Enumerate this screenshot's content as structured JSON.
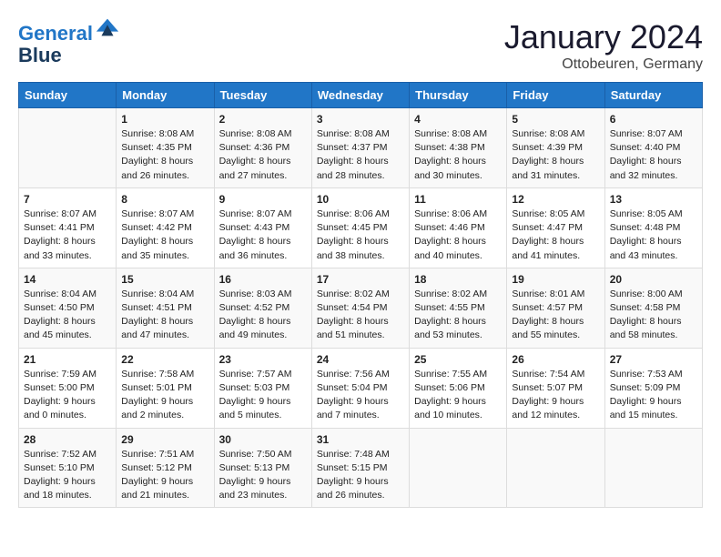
{
  "header": {
    "logo_line1": "General",
    "logo_line2": "Blue",
    "month": "January 2024",
    "location": "Ottobeuren, Germany"
  },
  "weekdays": [
    "Sunday",
    "Monday",
    "Tuesday",
    "Wednesday",
    "Thursday",
    "Friday",
    "Saturday"
  ],
  "weeks": [
    [
      {
        "day": "",
        "content": ""
      },
      {
        "day": "1",
        "content": "Sunrise: 8:08 AM\nSunset: 4:35 PM\nDaylight: 8 hours\nand 26 minutes."
      },
      {
        "day": "2",
        "content": "Sunrise: 8:08 AM\nSunset: 4:36 PM\nDaylight: 8 hours\nand 27 minutes."
      },
      {
        "day": "3",
        "content": "Sunrise: 8:08 AM\nSunset: 4:37 PM\nDaylight: 8 hours\nand 28 minutes."
      },
      {
        "day": "4",
        "content": "Sunrise: 8:08 AM\nSunset: 4:38 PM\nDaylight: 8 hours\nand 30 minutes."
      },
      {
        "day": "5",
        "content": "Sunrise: 8:08 AM\nSunset: 4:39 PM\nDaylight: 8 hours\nand 31 minutes."
      },
      {
        "day": "6",
        "content": "Sunrise: 8:07 AM\nSunset: 4:40 PM\nDaylight: 8 hours\nand 32 minutes."
      }
    ],
    [
      {
        "day": "7",
        "content": "Sunrise: 8:07 AM\nSunset: 4:41 PM\nDaylight: 8 hours\nand 33 minutes."
      },
      {
        "day": "8",
        "content": "Sunrise: 8:07 AM\nSunset: 4:42 PM\nDaylight: 8 hours\nand 35 minutes."
      },
      {
        "day": "9",
        "content": "Sunrise: 8:07 AM\nSunset: 4:43 PM\nDaylight: 8 hours\nand 36 minutes."
      },
      {
        "day": "10",
        "content": "Sunrise: 8:06 AM\nSunset: 4:45 PM\nDaylight: 8 hours\nand 38 minutes."
      },
      {
        "day": "11",
        "content": "Sunrise: 8:06 AM\nSunset: 4:46 PM\nDaylight: 8 hours\nand 40 minutes."
      },
      {
        "day": "12",
        "content": "Sunrise: 8:05 AM\nSunset: 4:47 PM\nDaylight: 8 hours\nand 41 minutes."
      },
      {
        "day": "13",
        "content": "Sunrise: 8:05 AM\nSunset: 4:48 PM\nDaylight: 8 hours\nand 43 minutes."
      }
    ],
    [
      {
        "day": "14",
        "content": "Sunrise: 8:04 AM\nSunset: 4:50 PM\nDaylight: 8 hours\nand 45 minutes."
      },
      {
        "day": "15",
        "content": "Sunrise: 8:04 AM\nSunset: 4:51 PM\nDaylight: 8 hours\nand 47 minutes."
      },
      {
        "day": "16",
        "content": "Sunrise: 8:03 AM\nSunset: 4:52 PM\nDaylight: 8 hours\nand 49 minutes."
      },
      {
        "day": "17",
        "content": "Sunrise: 8:02 AM\nSunset: 4:54 PM\nDaylight: 8 hours\nand 51 minutes."
      },
      {
        "day": "18",
        "content": "Sunrise: 8:02 AM\nSunset: 4:55 PM\nDaylight: 8 hours\nand 53 minutes."
      },
      {
        "day": "19",
        "content": "Sunrise: 8:01 AM\nSunset: 4:57 PM\nDaylight: 8 hours\nand 55 minutes."
      },
      {
        "day": "20",
        "content": "Sunrise: 8:00 AM\nSunset: 4:58 PM\nDaylight: 8 hours\nand 58 minutes."
      }
    ],
    [
      {
        "day": "21",
        "content": "Sunrise: 7:59 AM\nSunset: 5:00 PM\nDaylight: 9 hours\nand 0 minutes."
      },
      {
        "day": "22",
        "content": "Sunrise: 7:58 AM\nSunset: 5:01 PM\nDaylight: 9 hours\nand 2 minutes."
      },
      {
        "day": "23",
        "content": "Sunrise: 7:57 AM\nSunset: 5:03 PM\nDaylight: 9 hours\nand 5 minutes."
      },
      {
        "day": "24",
        "content": "Sunrise: 7:56 AM\nSunset: 5:04 PM\nDaylight: 9 hours\nand 7 minutes."
      },
      {
        "day": "25",
        "content": "Sunrise: 7:55 AM\nSunset: 5:06 PM\nDaylight: 9 hours\nand 10 minutes."
      },
      {
        "day": "26",
        "content": "Sunrise: 7:54 AM\nSunset: 5:07 PM\nDaylight: 9 hours\nand 12 minutes."
      },
      {
        "day": "27",
        "content": "Sunrise: 7:53 AM\nSunset: 5:09 PM\nDaylight: 9 hours\nand 15 minutes."
      }
    ],
    [
      {
        "day": "28",
        "content": "Sunrise: 7:52 AM\nSunset: 5:10 PM\nDaylight: 9 hours\nand 18 minutes."
      },
      {
        "day": "29",
        "content": "Sunrise: 7:51 AM\nSunset: 5:12 PM\nDaylight: 9 hours\nand 21 minutes."
      },
      {
        "day": "30",
        "content": "Sunrise: 7:50 AM\nSunset: 5:13 PM\nDaylight: 9 hours\nand 23 minutes."
      },
      {
        "day": "31",
        "content": "Sunrise: 7:48 AM\nSunset: 5:15 PM\nDaylight: 9 hours\nand 26 minutes."
      },
      {
        "day": "",
        "content": ""
      },
      {
        "day": "",
        "content": ""
      },
      {
        "day": "",
        "content": ""
      }
    ]
  ]
}
